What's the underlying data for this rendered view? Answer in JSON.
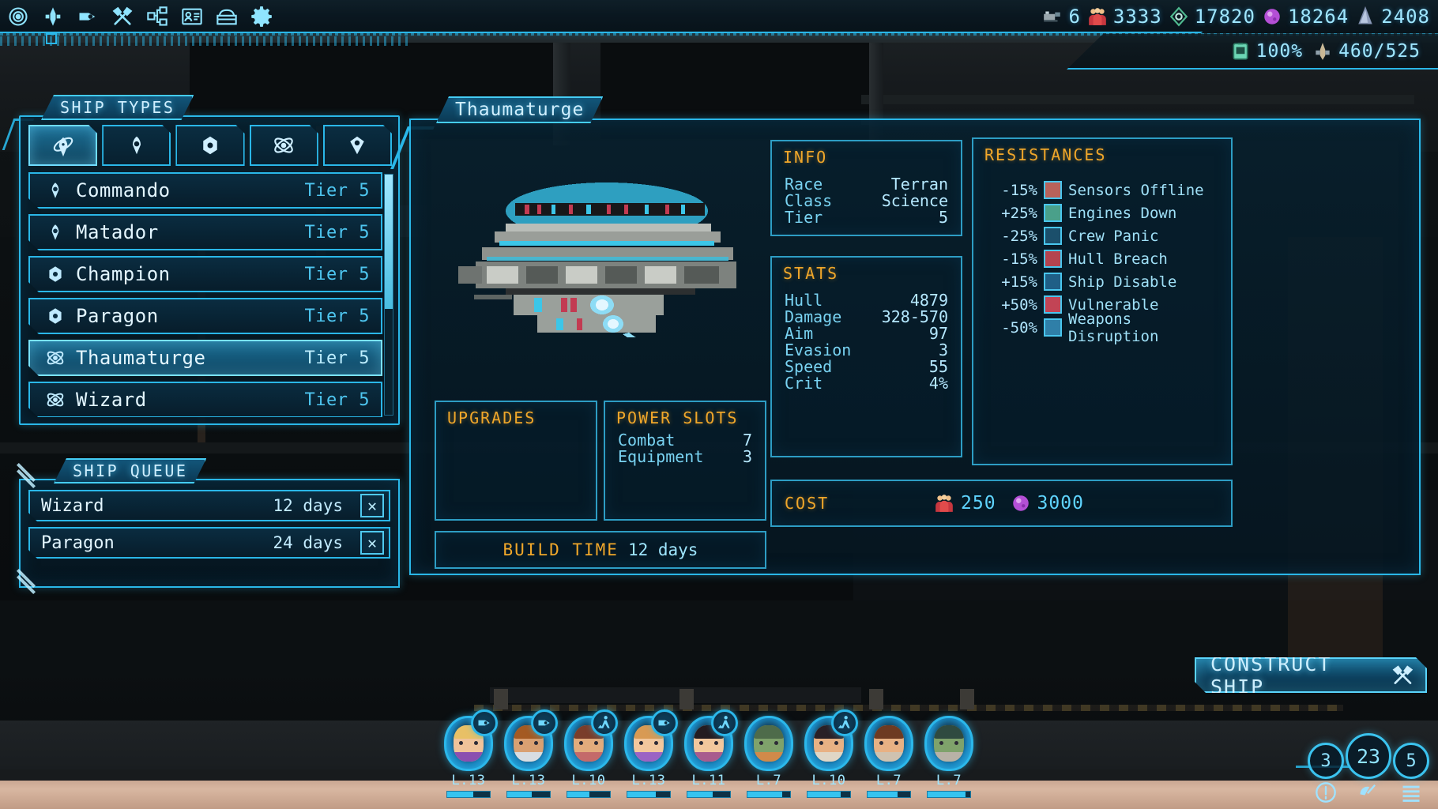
{
  "topbar": {
    "nav_icons": [
      "radar-icon",
      "fleet-icon",
      "ship-icon",
      "construct-tools-icon",
      "tech-tree-icon",
      "crew-roster-icon",
      "cargo-icon",
      "settings-gear-icon"
    ],
    "resources": [
      {
        "icon": "ship-count-icon",
        "value": "6"
      },
      {
        "icon": "crew-icon",
        "value": "3333"
      },
      {
        "icon": "credits-icon",
        "value": "17820"
      },
      {
        "icon": "nanites-icon",
        "value": "18264"
      },
      {
        "icon": "crystal-icon",
        "value": "2408"
      }
    ],
    "status": [
      {
        "icon": "battery-icon",
        "value": "100%"
      },
      {
        "icon": "fleet-power-icon",
        "value": "460/525"
      }
    ]
  },
  "ship_types": {
    "title": "SHIP TYPES",
    "tabs": [
      {
        "name": "tab-all",
        "icon": "atom-rocket-icon",
        "active": true
      },
      {
        "name": "tab-assault",
        "icon": "chevron-shield-icon",
        "active": false
      },
      {
        "name": "tab-defense",
        "icon": "hexagon-icon",
        "active": false
      },
      {
        "name": "tab-science",
        "icon": "atom-icon",
        "active": false
      },
      {
        "name": "tab-support",
        "icon": "chevron-diamond-icon",
        "active": false
      }
    ],
    "rows": [
      {
        "icon": "chevron-shield-icon",
        "name": "Commando",
        "tier": "Tier 5",
        "selected": false
      },
      {
        "icon": "chevron-shield-icon",
        "name": "Matador",
        "tier": "Tier 5",
        "selected": false
      },
      {
        "icon": "hexagon-icon",
        "name": "Champion",
        "tier": "Tier 5",
        "selected": false
      },
      {
        "icon": "hexagon-icon",
        "name": "Paragon",
        "tier": "Tier 5",
        "selected": false
      },
      {
        "icon": "atom-icon",
        "name": "Thaumaturge",
        "tier": "Tier 5",
        "selected": true
      },
      {
        "icon": "atom-icon",
        "name": "Wizard",
        "tier": "Tier 5",
        "selected": false
      }
    ]
  },
  "ship_queue": {
    "title": "SHIP QUEUE",
    "rows": [
      {
        "name": "Wizard",
        "days": "12 days",
        "cancel": "✕"
      },
      {
        "name": "Paragon",
        "days": "24 days",
        "cancel": "✕"
      }
    ]
  },
  "detail": {
    "title": "Thaumaturge",
    "ship_art": "thaumaturge-ship-sprite",
    "info": {
      "heading": "INFO",
      "rows": [
        {
          "label": "Race",
          "value": "Terran"
        },
        {
          "label": "Class",
          "value": "Science"
        },
        {
          "label": "Tier",
          "value": "5"
        }
      ]
    },
    "stats": {
      "heading": "STATS",
      "rows": [
        {
          "label": "Hull",
          "value": "4879"
        },
        {
          "label": "Damage",
          "value": "328-570"
        },
        {
          "label": "Aim",
          "value": "97"
        },
        {
          "label": "Evasion",
          "value": "3"
        },
        {
          "label": "Speed",
          "value": "55"
        },
        {
          "label": "Crit",
          "value": "4%"
        }
      ]
    },
    "resistances": {
      "heading": "RESISTANCES",
      "rows": [
        {
          "pct": "-15%",
          "icon": "sensors-offline-icon",
          "name": "Sensors Offline",
          "color": "#b9625a"
        },
        {
          "pct": "+25%",
          "icon": "engines-down-icon",
          "name": "Engines Down",
          "color": "#4aa08a"
        },
        {
          "pct": "-25%",
          "icon": "crew-panic-icon",
          "name": "Crew Panic",
          "color": "#1b4f6b"
        },
        {
          "pct": "-15%",
          "icon": "hull-breach-icon",
          "name": "Hull Breach",
          "color": "#b4434f"
        },
        {
          "pct": "+15%",
          "icon": "ship-disable-icon",
          "name": "Ship Disable",
          "color": "#1f5f86"
        },
        {
          "pct": "+50%",
          "icon": "vulnerable-icon",
          "name": "Vulnerable",
          "color": "#c24455"
        },
        {
          "pct": "-50%",
          "icon": "weapons-disruption-icon",
          "name": "Weapons Disruption",
          "color": "#2f7fa8"
        }
      ]
    },
    "upgrades": {
      "heading": "UPGRADES",
      "rows": []
    },
    "power_slots": {
      "heading": "POWER SLOTS",
      "rows": [
        {
          "label": "Combat",
          "value": "7"
        },
        {
          "label": "Equipment",
          "value": "3"
        }
      ]
    },
    "build_time": {
      "label": "BUILD TIME",
      "value": "12 days"
    },
    "cost": {
      "heading": "COST",
      "items": [
        {
          "icon": "crew-icon",
          "value": "250"
        },
        {
          "icon": "nanites-icon",
          "value": "3000"
        }
      ]
    }
  },
  "construct_button": {
    "label": "CONSTRUCT SHIP",
    "icon": "hammer-wrench-icon"
  },
  "crew": [
    {
      "level": "L.13",
      "badge": "ship-assign-icon",
      "bar_pct": 62,
      "hair": "#e8c066",
      "skin": "#f0c39a",
      "shirt": "#8b4fb0"
    },
    {
      "level": "L.13",
      "badge": "ship-assign-icon",
      "bar_pct": 58,
      "hair": "#a45a22",
      "skin": "#d9a072",
      "shirt": "#d8dde2"
    },
    {
      "level": "L.10",
      "badge": "work-assign-icon",
      "bar_pct": 52,
      "hair": "#7a3d2a",
      "skin": "#e2ab7c",
      "shirt": "#c46a6a"
    },
    {
      "level": "L.13",
      "badge": "ship-assign-icon",
      "bar_pct": 66,
      "hair": "#d89a54",
      "skin": "#f2c79d",
      "shirt": "#9b63c4"
    },
    {
      "level": "L.11",
      "badge": "work-assign-icon",
      "bar_pct": 60,
      "hair": "#241c20",
      "skin": "#f2c79d",
      "shirt": "#a85b8e"
    },
    {
      "level": "L.7",
      "badge": "",
      "bar_pct": 82,
      "hair": "#4e6b4a",
      "skin": "#7fa26b",
      "shirt": "#d08a4a"
    },
    {
      "level": "L.10",
      "badge": "work-assign-icon",
      "bar_pct": 78,
      "hair": "#2a2026",
      "skin": "#e8b184",
      "shirt": "#e0d6c6"
    },
    {
      "level": "L.7",
      "badge": "",
      "bar_pct": 70,
      "hair": "#6d3a22",
      "skin": "#e8b184",
      "shirt": "#cfc2b0"
    },
    {
      "level": "L.7",
      "badge": "",
      "bar_pct": 88,
      "hair": "#2f4a40",
      "skin": "#7fa26b",
      "shirt": "#b8b2a6"
    }
  ],
  "bottom_right_hud": [
    {
      "value": "3",
      "icon": "alert-exclamation-icon"
    },
    {
      "value": "23",
      "icon": "radar-dish-icon"
    },
    {
      "value": "5",
      "icon": "menu-lines-icon"
    }
  ]
}
